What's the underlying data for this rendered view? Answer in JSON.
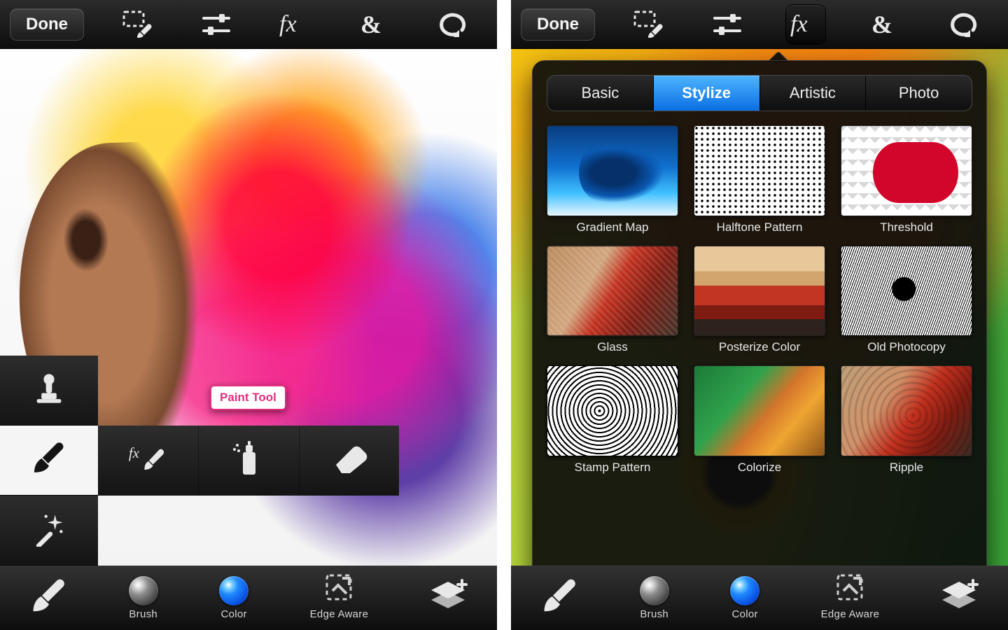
{
  "left": {
    "top": {
      "done": "Done"
    },
    "tooltip": "Paint Tool",
    "bottom": {
      "brush": "Brush",
      "color": "Color",
      "edge": "Edge Aware"
    }
  },
  "right": {
    "top": {
      "done": "Done"
    },
    "fx": {
      "tabs": {
        "basic": "Basic",
        "stylize": "Stylize",
        "artistic": "Artistic",
        "photo": "Photo"
      },
      "tiles": {
        "gradient": "Gradient Map",
        "halftone": "Halftone Pattern",
        "threshold": "Threshold",
        "glass": "Glass",
        "posterize": "Posterize Color",
        "photocopy": "Old Photocopy",
        "stamp": "Stamp Pattern",
        "colorize": "Colorize",
        "ripple": "Ripple"
      }
    },
    "bottom": {
      "brush": "Brush",
      "color": "Color",
      "edge": "Edge Aware"
    }
  }
}
